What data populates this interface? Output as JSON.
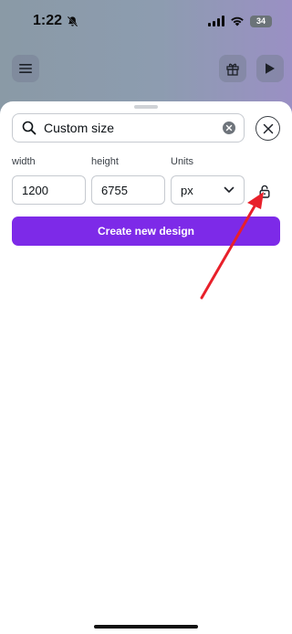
{
  "status_bar": {
    "time": "1:22",
    "battery": "34"
  },
  "background_toolbar": {
    "menu_icon": "hamburger-menu-icon",
    "gift_icon": "gift-icon",
    "play_icon": "play-icon"
  },
  "custom_size_sheet": {
    "search": {
      "value": "Custom size",
      "search_icon": "search-icon",
      "clear_icon": "clear-circle-x-icon"
    },
    "close_icon": "close-x-icon",
    "labels": {
      "width": "width",
      "height": "height",
      "units": "Units"
    },
    "values": {
      "width": "1200",
      "height": "6755",
      "units": "px"
    },
    "units_icon": "chevron-down-icon",
    "lock_icon": "unlocked-padlock-icon",
    "create_button": "Create new design"
  },
  "colors": {
    "accent": "#7d2ae8",
    "annotation_arrow": "#e8202a"
  }
}
